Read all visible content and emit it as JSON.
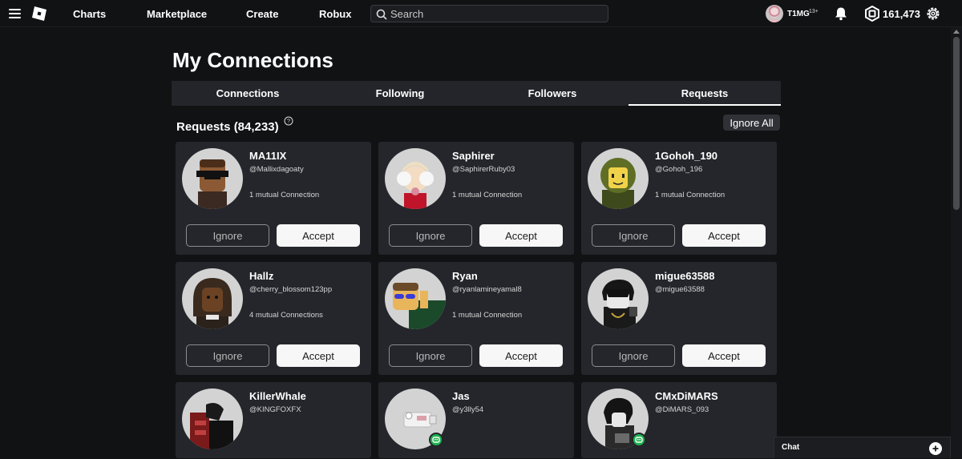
{
  "header": {
    "nav": [
      "Charts",
      "Marketplace",
      "Create",
      "Robux"
    ],
    "search_placeholder": "Search",
    "username": "T1MG",
    "age_badge": "13+",
    "robux": "161,473"
  },
  "page": {
    "title": "My Connections",
    "tabs": [
      "Connections",
      "Following",
      "Followers",
      "Requests"
    ],
    "active_tab": "Requests",
    "section_title": "Requests (84,233)",
    "ignore_all": "Ignore All"
  },
  "buttons": {
    "ignore": "Ignore",
    "accept": "Accept"
  },
  "requests": [
    {
      "name": "MA11IX",
      "handle": "@Mallixdagoaty",
      "mutual": "1 mutual Connection"
    },
    {
      "name": "Saphirer",
      "handle": "@SaphirerRuby03",
      "mutual": "1 mutual Connection"
    },
    {
      "name": "1Gohoh_190",
      "handle": "@Gohoh_196",
      "mutual": "1 mutual Connection"
    },
    {
      "name": "Hallz",
      "handle": "@cherry_blossom123pp",
      "mutual": "4 mutual Connections"
    },
    {
      "name": "Ryan",
      "handle": "@ryanlamineyamal8",
      "mutual": "1 mutual Connection"
    },
    {
      "name": "migue63588",
      "handle": "@migue63588",
      "mutual": ""
    },
    {
      "name": "KillerWhale",
      "handle": "@KINGFOXFX",
      "mutual": ""
    },
    {
      "name": "Jas",
      "handle": "@y3lly54",
      "mutual": ""
    },
    {
      "name": "CMxDiMARS",
      "handle": "@DiMARS_093",
      "mutual": ""
    }
  ],
  "chat": {
    "label": "Chat"
  },
  "colors": {
    "background": "#111214",
    "card": "#24262b",
    "status_online": "#1eb34f"
  }
}
